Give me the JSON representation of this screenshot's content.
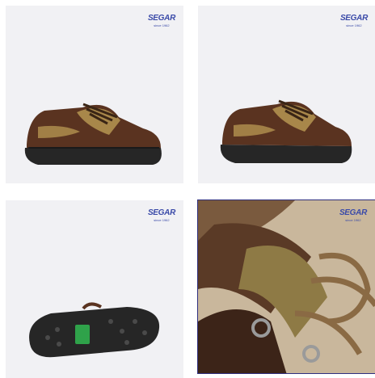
{
  "gallery": {
    "thumbnails": [
      {
        "brand": "SEGAR",
        "tagline": "since 1962",
        "selected": false
      },
      {
        "brand": "SEGAR",
        "tagline": "since 1962",
        "selected": false
      },
      {
        "brand": "SEGAR",
        "tagline": "since 1962",
        "selected": false
      },
      {
        "brand": "SEGAR",
        "tagline": "since 1962",
        "selected": true
      }
    ]
  },
  "colors": {
    "background": "#f1f1f4",
    "brand": "#3a4aa8",
    "selected_border": "#2f2f7e",
    "suede_dark": "#5a3320",
    "suede_light": "#a8874a",
    "sole": "#262626",
    "sole_badge": "#2fa24a"
  }
}
